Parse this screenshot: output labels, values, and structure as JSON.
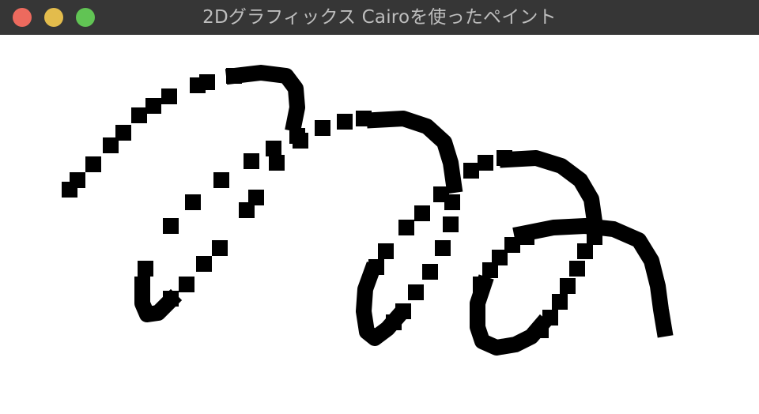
{
  "window": {
    "title": "2Dグラフィックス Cairoを使ったペイント"
  },
  "colors": {
    "titlebar": "#363636",
    "title_text": "#bdbdbd",
    "close": "#ed6a5e",
    "minimize": "#e3bc4c",
    "zoom": "#61c454",
    "canvas_background": "#ffffff",
    "brush": "#000000"
  },
  "icons": {
    "close": "close-button-icon",
    "minimize": "minimize-button-icon",
    "zoom": "zoom-button-icon"
  }
}
